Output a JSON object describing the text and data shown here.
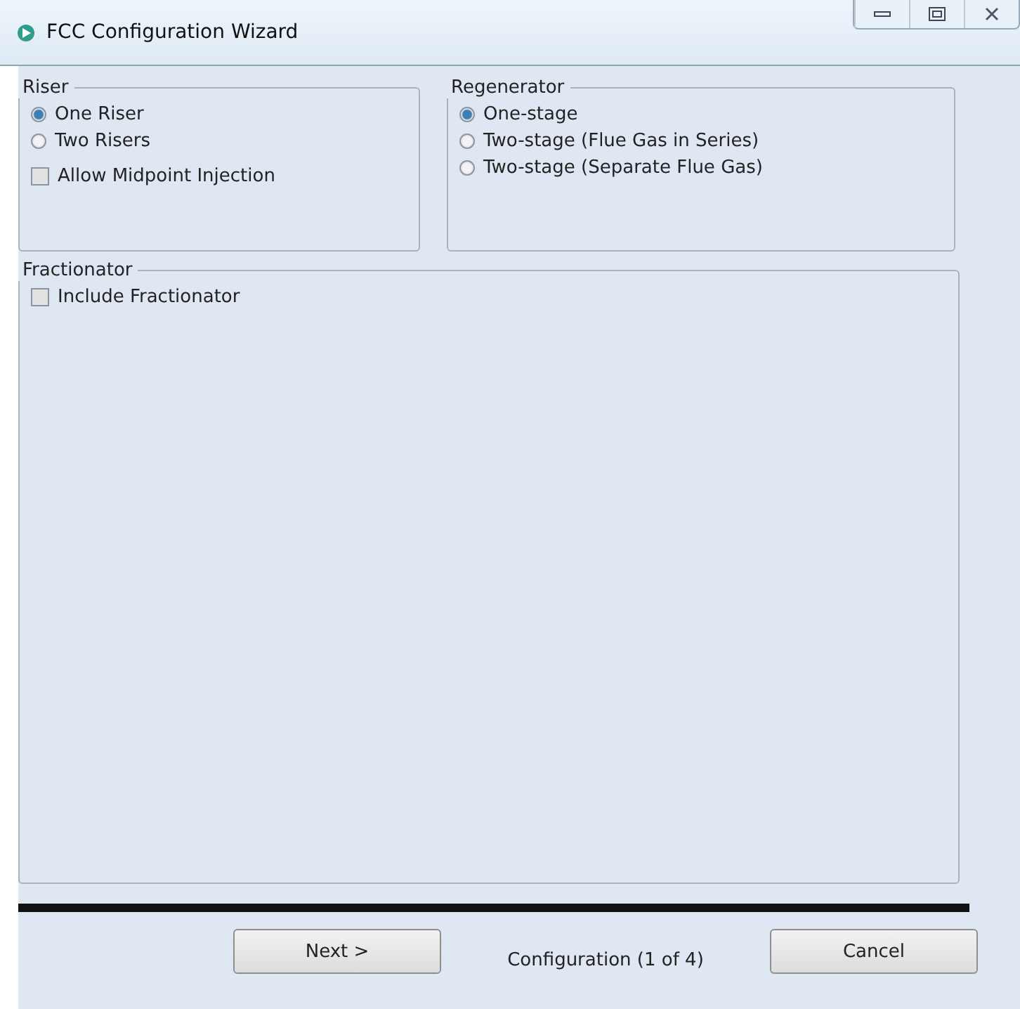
{
  "window": {
    "title": "FCC Configuration Wizard"
  },
  "riser": {
    "title": "Riser",
    "options": [
      {
        "label": "One Riser",
        "selected": true
      },
      {
        "label": "Two Risers",
        "selected": false
      }
    ],
    "midpoint": {
      "label": "Allow Midpoint Injection",
      "checked": false
    }
  },
  "regenerator": {
    "title": "Regenerator",
    "options": [
      {
        "label": "One-stage",
        "selected": true
      },
      {
        "label": "Two-stage (Flue Gas in Series)",
        "selected": false
      },
      {
        "label": "Two-stage (Separate Flue Gas)",
        "selected": false
      }
    ]
  },
  "fractionator": {
    "title": "Fractionator",
    "include": {
      "label": "Include Fractionator",
      "checked": false
    }
  },
  "footer": {
    "next": "Next >",
    "status": "Configuration (1 of 4)",
    "cancel": "Cancel"
  }
}
